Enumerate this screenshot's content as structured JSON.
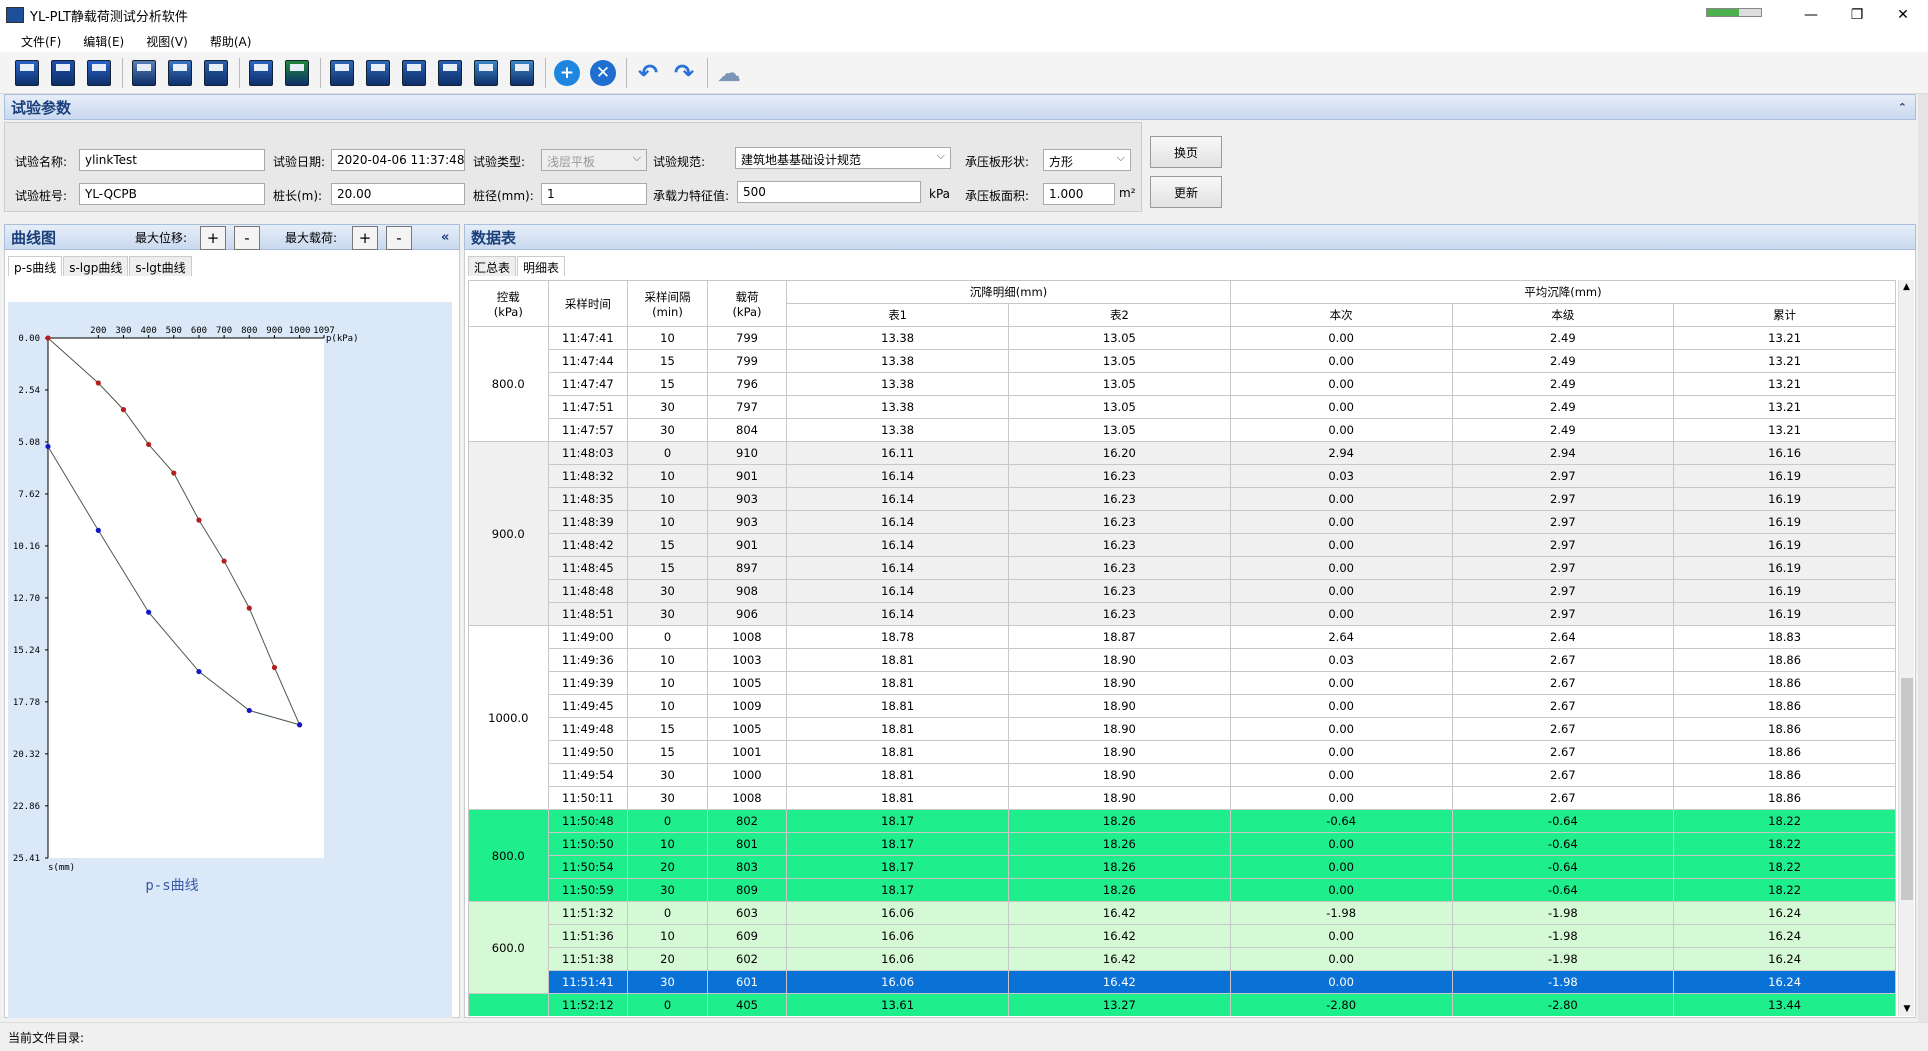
{
  "window": {
    "title": "YL-PLT静载荷测试分析软件",
    "minimize": "—",
    "restore": "❐",
    "close": "✕"
  },
  "menu": [
    "文件(F)",
    "编辑(E)",
    "视图(V)",
    "帮助(A)"
  ],
  "toolbar_icons": [
    "new-file-icon",
    "save-icon",
    "save-as-icon",
    "settings-icon",
    "preview-icon",
    "print-icon",
    "export-word-icon",
    "export-excel-icon",
    "report-icon",
    "report-list-icon",
    "layers-icon",
    "layers-export-icon",
    "refresh-icon",
    "download-icon",
    "add-icon",
    "remove-icon",
    "undo-icon",
    "redo-icon",
    "cloud-icon"
  ],
  "params": {
    "header": "试验参数",
    "name_label": "试验名称:",
    "name_value": "ylinkTest",
    "date_label": "试验日期:",
    "date_value": "2020-04-06 11:37:48",
    "type_label": "试验类型:",
    "type_value": "浅层平板",
    "spec_label": "试验规范:",
    "spec_value": "建筑地基基础设计规范",
    "shape_label": "承压板形状:",
    "shape_value": "方形",
    "pile_label": "试验桩号:",
    "pile_value": "YL-QCPB",
    "length_label": "桩长(m):",
    "length_value": "20.00",
    "diam_label": "桩径(mm):",
    "diam_value": "1",
    "capacity_label": "承载力特征值:",
    "capacity_value": "500",
    "capacity_unit": "kPa",
    "area_label": "承压板面积:",
    "area_value": "1.000",
    "area_unit": "m²",
    "page_btn": "换页",
    "update_btn": "更新"
  },
  "curve": {
    "header": "曲线图",
    "max_disp_label": "最大位移:",
    "max_load_label": "最大载荷:",
    "plus": "+",
    "minus": "-",
    "collapse": "«",
    "tabs": [
      "p-s曲线",
      "s-lgp曲线",
      "s-lgt曲线"
    ],
    "x_label": "p(kPa)",
    "y_label": "s(mm)",
    "chart_title": "p-s曲线"
  },
  "chart_data": {
    "type": "line",
    "x_ticks": [
      "200",
      "300",
      "400",
      "500",
      "600",
      "700",
      "800",
      "900",
      "1000",
      "1097"
    ],
    "x_tick_values": [
      200,
      300,
      400,
      500,
      600,
      700,
      800,
      900,
      1000,
      1097
    ],
    "y_ticks": [
      "0.00",
      "2.54",
      "5.08",
      "7.62",
      "10.16",
      "12.70",
      "15.24",
      "17.78",
      "20.32",
      "22.86",
      "25.41"
    ],
    "y_tick_values": [
      0,
      2.54,
      5.08,
      7.62,
      10.16,
      12.7,
      15.24,
      17.78,
      20.32,
      22.86,
      25.41
    ],
    "xlim": [
      0,
      1097
    ],
    "ylim": [
      0,
      25.41
    ],
    "series": [
      {
        "color": "#b22020",
        "points": [
          [
            0,
            0
          ],
          [
            200,
            2.2
          ],
          [
            300,
            3.5
          ],
          [
            400,
            5.2
          ],
          [
            500,
            6.6
          ],
          [
            600,
            8.9
          ],
          [
            700,
            10.9
          ],
          [
            800,
            13.2
          ],
          [
            900,
            16.1
          ],
          [
            1000,
            18.9
          ]
        ]
      },
      {
        "color": "#1515c8",
        "points": [
          [
            1000,
            18.9
          ],
          [
            800,
            18.2
          ],
          [
            600,
            16.3
          ],
          [
            400,
            13.4
          ],
          [
            200,
            9.4
          ],
          [
            0,
            5.3
          ]
        ]
      }
    ]
  },
  "table": {
    "header": "数据表",
    "tabs": [
      "汇总表",
      "明细表"
    ],
    "col_headers": {
      "load": "控载\n(kPa)",
      "time": "采样时间",
      "interval": "采样间隔\n(min)",
      "load2": "载荷\n(kPa)",
      "detail": "沉降明细(mm)",
      "g1": "表1",
      "g2": "表2",
      "avg": "平均沉降(mm)",
      "this": "本次",
      "level": "本级",
      "total": "累计"
    },
    "groups": [
      {
        "load": "800.0",
        "style": "white",
        "rows": [
          [
            "11:47:41",
            "10",
            "799",
            "13.38",
            "13.05",
            "0.00",
            "2.49",
            "13.21"
          ],
          [
            "11:47:44",
            "15",
            "799",
            "13.38",
            "13.05",
            "0.00",
            "2.49",
            "13.21"
          ],
          [
            "11:47:47",
            "15",
            "796",
            "13.38",
            "13.05",
            "0.00",
            "2.49",
            "13.21"
          ],
          [
            "11:47:51",
            "30",
            "797",
            "13.38",
            "13.05",
            "0.00",
            "2.49",
            "13.21"
          ],
          [
            "11:47:57",
            "30",
            "804",
            "13.38",
            "13.05",
            "0.00",
            "2.49",
            "13.21"
          ]
        ]
      },
      {
        "load": "900.0",
        "style": "gray",
        "rows": [
          [
            "11:48:03",
            "0",
            "910",
            "16.11",
            "16.20",
            "2.94",
            "2.94",
            "16.16"
          ],
          [
            "11:48:32",
            "10",
            "901",
            "16.14",
            "16.23",
            "0.03",
            "2.97",
            "16.19"
          ],
          [
            "11:48:35",
            "10",
            "903",
            "16.14",
            "16.23",
            "0.00",
            "2.97",
            "16.19"
          ],
          [
            "11:48:39",
            "10",
            "903",
            "16.14",
            "16.23",
            "0.00",
            "2.97",
            "16.19"
          ],
          [
            "11:48:42",
            "15",
            "901",
            "16.14",
            "16.23",
            "0.00",
            "2.97",
            "16.19"
          ],
          [
            "11:48:45",
            "15",
            "897",
            "16.14",
            "16.23",
            "0.00",
            "2.97",
            "16.19"
          ],
          [
            "11:48:48",
            "30",
            "908",
            "16.14",
            "16.23",
            "0.00",
            "2.97",
            "16.19"
          ],
          [
            "11:48:51",
            "30",
            "906",
            "16.14",
            "16.23",
            "0.00",
            "2.97",
            "16.19"
          ]
        ]
      },
      {
        "load": "1000.0",
        "style": "white",
        "rows": [
          [
            "11:49:00",
            "0",
            "1008",
            "18.78",
            "18.87",
            "2.64",
            "2.64",
            "18.83"
          ],
          [
            "11:49:36",
            "10",
            "1003",
            "18.81",
            "18.90",
            "0.03",
            "2.67",
            "18.86"
          ],
          [
            "11:49:39",
            "10",
            "1005",
            "18.81",
            "18.90",
            "0.00",
            "2.67",
            "18.86"
          ],
          [
            "11:49:45",
            "10",
            "1009",
            "18.81",
            "18.90",
            "0.00",
            "2.67",
            "18.86"
          ],
          [
            "11:49:48",
            "15",
            "1005",
            "18.81",
            "18.90",
            "0.00",
            "2.67",
            "18.86"
          ],
          [
            "11:49:50",
            "15",
            "1001",
            "18.81",
            "18.90",
            "0.00",
            "2.67",
            "18.86"
          ],
          [
            "11:49:54",
            "30",
            "1000",
            "18.81",
            "18.90",
            "0.00",
            "2.67",
            "18.86"
          ],
          [
            "11:50:11",
            "30",
            "1008",
            "18.81",
            "18.90",
            "0.00",
            "2.67",
            "18.86"
          ]
        ]
      },
      {
        "load": "800.0",
        "style": "green",
        "rows": [
          [
            "11:50:48",
            "0",
            "802",
            "18.17",
            "18.26",
            "-0.64",
            "-0.64",
            "18.22"
          ],
          [
            "11:50:50",
            "10",
            "801",
            "18.17",
            "18.26",
            "0.00",
            "-0.64",
            "18.22"
          ],
          [
            "11:50:54",
            "20",
            "803",
            "18.17",
            "18.26",
            "0.00",
            "-0.64",
            "18.22"
          ],
          [
            "11:50:59",
            "30",
            "809",
            "18.17",
            "18.26",
            "0.00",
            "-0.64",
            "18.22"
          ]
        ]
      },
      {
        "load": "600.0",
        "style": "lightgreen",
        "rows": [
          [
            "11:51:32",
            "0",
            "603",
            "16.06",
            "16.42",
            "-1.98",
            "-1.98",
            "16.24"
          ],
          [
            "11:51:36",
            "10",
            "609",
            "16.06",
            "16.42",
            "0.00",
            "-1.98",
            "16.24"
          ],
          [
            "11:51:38",
            "20",
            "602",
            "16.06",
            "16.42",
            "0.00",
            "-1.98",
            "16.24"
          ],
          [
            "11:51:41",
            "30",
            "601",
            "16.06",
            "16.42",
            "0.00",
            "-1.98",
            "16.24"
          ]
        ]
      },
      {
        "load": "",
        "style": "green",
        "rows": [
          [
            "11:52:12",
            "0",
            "405",
            "13.61",
            "13.27",
            "-2.80",
            "-2.80",
            "13.44"
          ]
        ]
      }
    ],
    "selected_row": "11:51:41"
  },
  "status": {
    "label": "当前文件目录:"
  },
  "colors": {
    "green": "#1fee8d",
    "lightgreen": "#d5f8d5",
    "gray": "#f0f0f0",
    "selected": "#0a72d6",
    "header_text": "#1b3f7a"
  }
}
